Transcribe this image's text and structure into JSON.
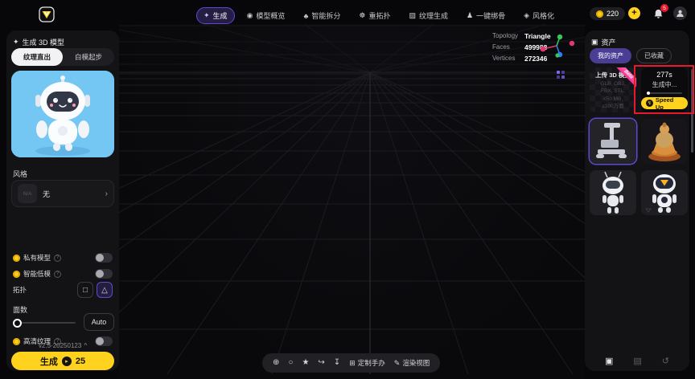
{
  "topbar": {
    "nav": [
      {
        "label": "生成",
        "glyph": "✦",
        "active": true
      },
      {
        "label": "模型概览",
        "glyph": "◉"
      },
      {
        "label": "智能拆分",
        "glyph": "♣"
      },
      {
        "label": "重拓扑",
        "glyph": "☸"
      },
      {
        "label": "纹理生成",
        "glyph": "▨"
      },
      {
        "label": "一键绑骨",
        "glyph": "♟"
      },
      {
        "label": "风格化",
        "glyph": "◈"
      }
    ],
    "credits": "220",
    "notifications": "5"
  },
  "left_panel": {
    "title": "生成 3D 模型",
    "tab_texture": "纹理直出",
    "tab_white": "白模起步",
    "style_label": "风格",
    "style_na": "N/A",
    "style_value": "无",
    "opt_private": "私有模型",
    "opt_lowpoly": "智能低模",
    "topology_label": "拓扑",
    "faces_label": "面数",
    "auto_label": "Auto",
    "hd_texture": "高清纹理",
    "version": "v2.5-20250123",
    "generate": "生成",
    "generate_cost": "25"
  },
  "viewport": {
    "topology_label": "Topology",
    "topology_value": "Triangle",
    "faces_label": "Faces",
    "faces_value": "499988",
    "vertices_label": "Vertices",
    "vertices_value": "272346"
  },
  "toolbar": {
    "merch": "定制手办",
    "render": "渲染视图"
  },
  "right_panel": {
    "title": "资产",
    "tab_mine": "我的资产",
    "tab_fav": "已收藏",
    "upload_title": "上传 3D 模型",
    "upload_beta": "Beta",
    "upload_formats": "GLB, OBJ,\nFBX, STL,\n<50 MB,\n≤100万面",
    "gen_time": "277s",
    "gen_status": "生成中...",
    "speed_up": "Speed Up"
  },
  "glyphs": {
    "plus": "+",
    "question": "?",
    "chevron_right": "›",
    "chevron_up": "^",
    "square": "□",
    "triangle": "△",
    "focus": "⊕",
    "orbit": "○",
    "star": "★",
    "share": "↪",
    "download": "↧",
    "merch": "⊞",
    "render": "✎",
    "assets": "▣",
    "sparkle": "✦",
    "cube": "▣",
    "layers": "▤",
    "history": "↺",
    "coin_arrow": "▸",
    "lightning": "↯"
  },
  "colors": {
    "accent_purple": "#5b4bd4",
    "accent_yellow": "#ffd21e",
    "highlight_red": "#e8192c"
  }
}
